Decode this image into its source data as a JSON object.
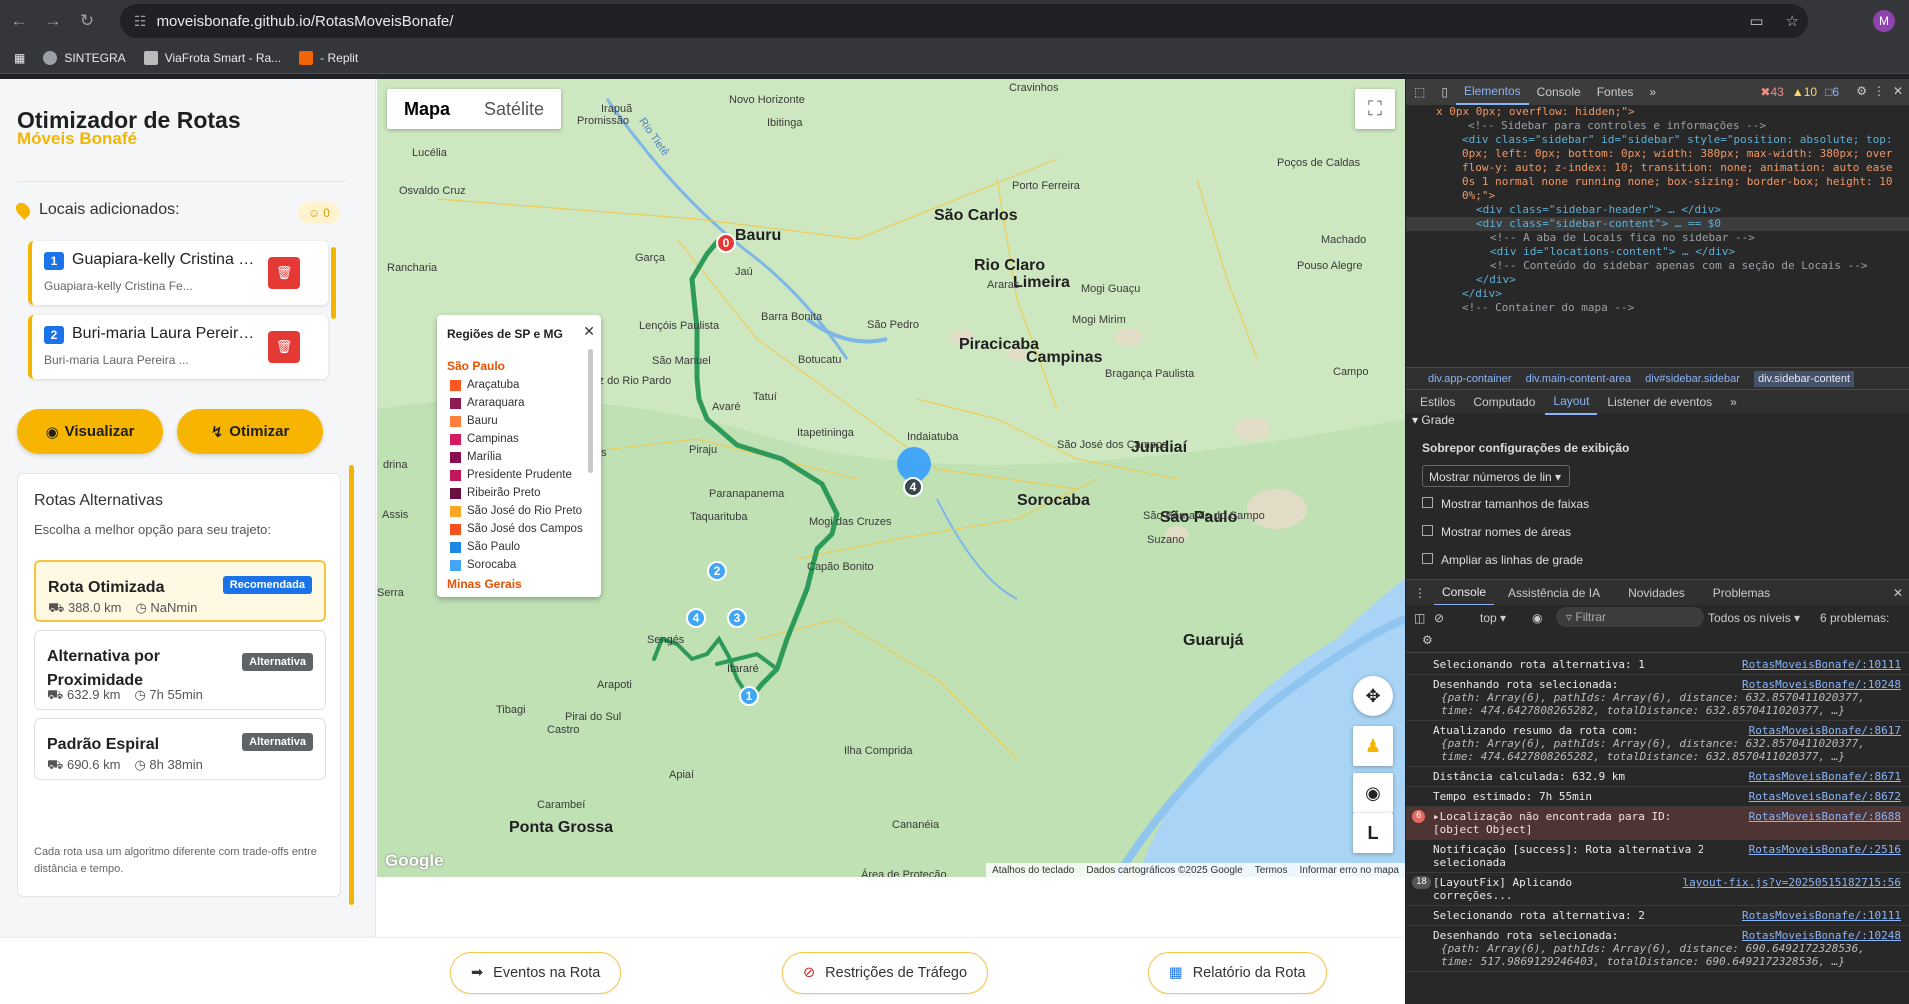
{
  "browser": {
    "url": "moveisbonafe.github.io/RotasMoveisBonafe/",
    "profile_initial": "M",
    "bookmarks": [
      "SINTEGRA",
      "ViaFrota Smart - Ra...",
      "- Replit"
    ]
  },
  "sidebar": {
    "title": "Otimizador de Rotas",
    "subtitle": "Móveis Bonafé",
    "locations_label": "Locais adicionados:",
    "locations_count": "0",
    "locations": [
      {
        "num": "1",
        "name": "Guapiara-kelly Cristina Fe...",
        "sub": "Guapiara-kelly Cristina Fe..."
      },
      {
        "num": "2",
        "name": "Buri-maria Laura Pereira ...",
        "sub": "Buri-maria Laura Pereira ..."
      }
    ],
    "visualize_label": "Visualizar",
    "optimize_label": "Otimizar",
    "alt_title": "Rotas Alternativas",
    "alt_desc": "Escolha a melhor opção para seu trajeto:",
    "routes": [
      {
        "name": "Rota Otimizada",
        "badge": "Recomendada",
        "distance": "388.0 km",
        "time": "NaNmin",
        "badge_color": "#1a73e8"
      },
      {
        "name": "Alternativa por Proximidade",
        "badge": "Alternativa",
        "distance": "632.9 km",
        "time": "7h 55min",
        "badge_color": "#5f6368"
      },
      {
        "name": "Padrão Espiral",
        "badge": "Alternativa",
        "distance": "690.6 km",
        "time": "8h 38min",
        "badge_color": "#5f6368"
      }
    ],
    "alt_footer": "Cada rota usa um algoritmo diferente com trade-offs entre distância e tempo."
  },
  "map": {
    "tab_map": "Mapa",
    "tab_satellite": "Satélite",
    "legend": {
      "title": "Regiões de SP e MG",
      "group_sp": "São Paulo",
      "items": [
        {
          "label": "Araçatuba",
          "color": "#ff5722"
        },
        {
          "label": "Araraquara",
          "color": "#8e1b4f"
        },
        {
          "label": "Bauru",
          "color": "#ff7f3f"
        },
        {
          "label": "Campinas",
          "color": "#d81b60"
        },
        {
          "label": "Marília",
          "color": "#880e4f"
        },
        {
          "label": "Presidente Prudente",
          "color": "#c2185b"
        },
        {
          "label": "Ribeirão Preto",
          "color": "#6a1040"
        },
        {
          "label": "São José do Rio Preto",
          "color": "#f9a825"
        },
        {
          "label": "São José dos Campos",
          "color": "#f4511e"
        },
        {
          "label": "São Paulo",
          "color": "#1e88e5"
        },
        {
          "label": "Sorocaba",
          "color": "#42a5f5"
        }
      ],
      "group_mg": "Minas Gerais"
    },
    "places": [
      {
        "t": "Bauru",
        "b": true
      },
      {
        "t": "São Carlos",
        "b": true
      },
      {
        "t": "Rio Claro",
        "b": true
      },
      {
        "t": "Limeira",
        "b": true
      },
      {
        "t": "Piracicaba",
        "b": true
      },
      {
        "t": "Campinas",
        "b": true
      },
      {
        "t": "Sorocaba",
        "b": true
      },
      {
        "t": "São Paulo",
        "b": true
      },
      {
        "t": "Jundiaí",
        "b": true
      },
      {
        "t": "Guarujá",
        "b": true
      },
      {
        "t": "Ponta Grossa",
        "b": true
      },
      {
        "t": "Jaú",
        "b": false
      },
      {
        "t": "Barra Bonita",
        "b": false
      },
      {
        "t": "Botucatu",
        "b": false
      },
      {
        "t": "Itapetininga",
        "b": false
      },
      {
        "t": "Capão Bonito",
        "b": false
      },
      {
        "t": "Tatuí",
        "b": false
      },
      {
        "t": "Mogi das Cruzes",
        "b": false
      },
      {
        "t": "São Bernardo do Campo",
        "b": false
      },
      {
        "t": "Suzano",
        "b": false
      },
      {
        "t": "São José dos Campos",
        "b": false
      },
      {
        "t": "Paranapanema",
        "b": false
      },
      {
        "t": "Avaré",
        "b": false
      },
      {
        "t": "Lençóis Paulista",
        "b": false
      },
      {
        "t": "São Manuel",
        "b": false
      },
      {
        "t": "São Pedro",
        "b": false
      },
      {
        "t": "Indaiatuba",
        "b": false
      },
      {
        "t": "Mogi Mirim",
        "b": false
      },
      {
        "t": "Mogi Guaçu",
        "b": false
      },
      {
        "t": "Bragança Paulista",
        "b": false
      },
      {
        "t": "Porto Ferreira",
        "b": false
      },
      {
        "t": "Araras",
        "b": false
      },
      {
        "t": "Itararé",
        "b": false
      },
      {
        "t": "Piraju",
        "b": false
      },
      {
        "t": "Taquarituba",
        "b": false
      },
      {
        "t": "Sengés",
        "b": false
      },
      {
        "t": "Apiaí",
        "b": false
      },
      {
        "t": "Castro",
        "b": false
      },
      {
        "t": "Carambeí",
        "b": false
      },
      {
        "t": "Tibagi",
        "b": false
      },
      {
        "t": "Cananéia",
        "b": false
      },
      {
        "t": "Ilha Comprida",
        "b": false
      },
      {
        "t": "Área de Proteção",
        "b": false
      },
      {
        "t": "Pouso Alegre",
        "b": false
      },
      {
        "t": "Machado",
        "b": false
      },
      {
        "t": "Poços de Caldas",
        "b": false
      },
      {
        "t": "Cravinhos",
        "b": false
      },
      {
        "t": "Osvaldo Cruz",
        "b": false
      },
      {
        "t": "Rancharia",
        "b": false
      },
      {
        "t": "Garça",
        "b": false
      },
      {
        "t": "Lucélia",
        "b": false
      },
      {
        "t": "Promissão",
        "b": false
      },
      {
        "t": "Irapuã",
        "b": false
      },
      {
        "t": "Novo Horizonte",
        "b": false
      },
      {
        "t": "Ibitinga",
        "b": false
      },
      {
        "t": "Serra",
        "b": false
      },
      {
        "t": "Pirai do Sul",
        "b": false
      },
      {
        "t": "Arapoti",
        "b": false
      },
      {
        "t": "Santa Cruz do Rio Pardo",
        "b": false
      },
      {
        "t": "Ourinhos",
        "b": false
      },
      {
        "t": "Assis",
        "b": false
      },
      {
        "t": "drina",
        "b": false
      },
      {
        "t": "Campo",
        "b": false
      },
      {
        "t": "Rio Tietê",
        "b": false
      }
    ],
    "markers": [
      {
        "label": "0",
        "color": "#e53935"
      },
      {
        "label": "1",
        "color": "#42a5f5"
      },
      {
        "label": "2",
        "color": "#42a5f5"
      },
      {
        "label": "3",
        "color": "#42a5f5"
      },
      {
        "label": "4",
        "color": "#42a5f5"
      },
      {
        "label": "4",
        "color": "#37474f"
      }
    ],
    "footer": [
      "Atalhos do teclado",
      "Dados cartográficos ©2025 Google",
      "Termos",
      "Informar erro no mapa"
    ],
    "google_logo": "Google",
    "pegman_label": "L"
  },
  "bottom_tabs": [
    {
      "label": "Eventos na Rota"
    },
    {
      "label": "Restrições de Tráfego"
    },
    {
      "label": "Relatório da Rota"
    }
  ],
  "devtools": {
    "tabs": [
      "Elementos",
      "Console",
      "Fontes"
    ],
    "errors": "43",
    "warnings": "10",
    "infos": "6",
    "code_lines": [
      "x 0px 0px; overflow: hidden;\">",
      "<!-- Sidebar para controles e informações -->",
      "<div class=\"sidebar\" id=\"sidebar\" style=\"position: absolute; top:",
      "0px; left: 0px; bottom: 0px; width: 380px; max-width: 380px; over",
      "flow-y: auto; z-index: 10; transition: none; animation: auto ease",
      "0s 1 normal none running none; box-sizing: border-box; height: 10",
      "0%;\">",
      "<div class=\"sidebar-header\"> … </div>",
      "<div class=\"sidebar-content\"> … == $0",
      "<!-- A aba de Locais fica no sidebar -->",
      "<div id=\"locations-content\"> … </div>",
      "<!-- Conteúdo do sidebar apenas com a seção de Locais -->",
      "</div>",
      "</div>",
      "<!-- Container do mapa -->"
    ],
    "breadcrumbs": [
      "div.app-container",
      "div.main-content-area",
      "div#sidebar.sidebar",
      "div.sidebar-content"
    ],
    "sub_tabs": [
      "Estilos",
      "Computado",
      "Layout",
      "Listener de eventos"
    ],
    "layout": {
      "grid": "Grade",
      "overlay_title": "Sobrepor configurações de exibição",
      "select": "Mostrar números de lin",
      "checks": [
        "Mostrar tamanhos de faixas",
        "Mostrar nomes de áreas",
        "Ampliar as linhas de grade"
      ]
    },
    "console_tabs": [
      "Console",
      "Assistência de IA",
      "Novidades",
      "Problemas"
    ],
    "console_toolbar": {
      "context": "top",
      "filter": "Filtrar",
      "levels": "Todos os níveis",
      "problems": "6 problemas:"
    },
    "messages": [
      {
        "text": "Selecionando rota alternativa: 1",
        "src": "RotasMoveisBonafe/:10111",
        "type": "log"
      },
      {
        "text": "Desenhando rota selecionada:",
        "src": "RotasMoveisBonafe/:10248",
        "type": "log",
        "obj": [
          "{path: Array(6), pathIds: Array(6), distance: 632.8570411020377,",
          "time: 474.6427808265282, totalDistance: 632.8570411020377, …}"
        ]
      },
      {
        "text": "Atualizando resumo da rota com:",
        "src": "RotasMoveisBonafe/:8617",
        "type": "log",
        "obj": [
          "{path: Array(6), pathIds: Array(6), distance: 632.8570411020377,",
          "time: 474.6427808265282, totalDistance: 632.8570411020377, …}"
        ]
      },
      {
        "text": "Distância calculada: 632.9 km",
        "src": "RotasMoveisBonafe/:8671",
        "type": "log"
      },
      {
        "text": "Tempo estimado: 7h 55min",
        "src": "RotasMoveisBonafe/:8672",
        "type": "log"
      },
      {
        "text": "▸Localização não encontrada para ID:",
        "text2": "[object Object]",
        "src": "RotasMoveisBonafe/:8688",
        "type": "err",
        "count": "6"
      },
      {
        "text": "Notificação [success]: Rota alternativa 2",
        "text2": "selecionada",
        "src": "RotasMoveisBonafe/:2516",
        "type": "log"
      },
      {
        "text": "[LayoutFix] Aplicando",
        "text2": "correções...",
        "src": "layout-fix.js?v=20250515182715:56",
        "type": "log",
        "count": "18"
      },
      {
        "text": "Selecionando rota alternativa: 2",
        "src": "RotasMoveisBonafe/:10111",
        "type": "log"
      },
      {
        "text": "Desenhando rota selecionada:",
        "src": "RotasMoveisBonafe/:10248",
        "type": "log",
        "obj": [
          "{path: Array(6), pathIds: Array(6), distance: 690.6492172328536,",
          "time: 517.9869129246403, totalDistance: 690.6492172328536, …}"
        ]
      }
    ]
  }
}
